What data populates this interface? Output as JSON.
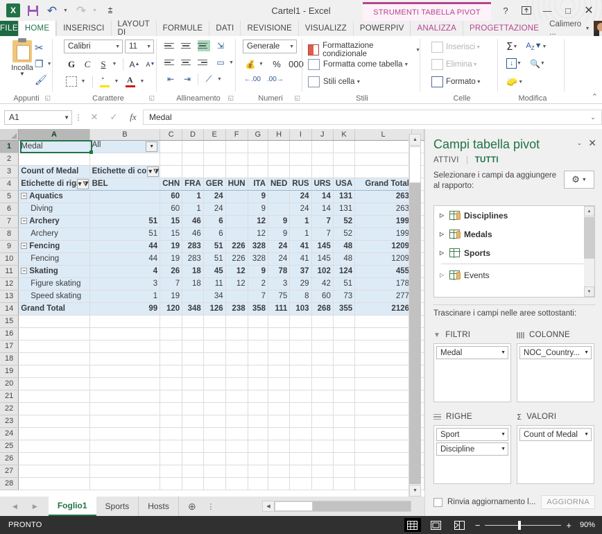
{
  "titlebar": {
    "document_title": "Cartel1 - Excel",
    "contextual_group": "STRUMENTI TABELLA PIVOT",
    "quick_access": [
      "excel-logo",
      "save",
      "undo",
      "redo",
      "customize"
    ],
    "help": "?",
    "ribbon_display": "ribbon-options",
    "minimize": "—",
    "restore": "□",
    "close": "✕"
  },
  "tabs": {
    "file": "FILE",
    "items": [
      {
        "label": "HOME",
        "active": true
      },
      {
        "label": "INSERISCI",
        "active": false
      },
      {
        "label": "LAYOUT DI",
        "active": false
      },
      {
        "label": "FORMULE",
        "active": false
      },
      {
        "label": "DATI",
        "active": false
      },
      {
        "label": "REVISIONE",
        "active": false
      },
      {
        "label": "VISUALIZZ",
        "active": false
      },
      {
        "label": "POWERPIV",
        "active": false
      },
      {
        "label": "ANALIZZA",
        "active": false,
        "contextual": true
      },
      {
        "label": "PROGETTAZIONE",
        "active": false,
        "contextual": true
      }
    ],
    "user": "Calimero ..."
  },
  "ribbon": {
    "groups": [
      {
        "label": "Appunti"
      },
      {
        "label": "Carattere"
      },
      {
        "label": "Allineamento"
      },
      {
        "label": "Numeri"
      },
      {
        "label": "Stili"
      },
      {
        "label": "Celle"
      },
      {
        "label": "Modifica"
      }
    ],
    "clipboard": {
      "paste": "Incolla",
      "cut": "cut-icon",
      "copy": "copy-icon",
      "format_painter": "format-painter-icon"
    },
    "font": {
      "family": "Calibri",
      "size": "11",
      "bold": "G",
      "italic": "C",
      "underline": "S",
      "grow": "A",
      "shrink": "A",
      "highlight": "A",
      "color": "A"
    },
    "number": {
      "format": "Generale",
      "percent": "%",
      "thousands": "000"
    },
    "styles": {
      "conditional": "Formattazione condizionale",
      "as_table": "Formatta come tabella",
      "cell_styles": "Stili cella"
    },
    "cells": {
      "insert": "Inserisci",
      "delete": "Elimina",
      "format": "Formato"
    },
    "editing": {
      "autosum": "Σ",
      "sort": "sort-filter-icon",
      "fill": "fill-icon",
      "find": "find-icon",
      "clear": "clear-icon"
    },
    "collapse": "collapse-ribbon-icon"
  },
  "formula_bar": {
    "name_box": "A1",
    "cancel": "✕",
    "enter": "✓",
    "fx": "fx",
    "value": "Medal",
    "expand": "⌄"
  },
  "grid": {
    "column_headers": [
      "A",
      "B",
      "C",
      "D",
      "E",
      "F",
      "G",
      "H",
      "I",
      "J",
      "K",
      "L"
    ],
    "selected_column": "A",
    "selected_row": 1,
    "row_numbers": [
      1,
      2,
      3,
      4,
      5,
      6,
      7,
      8,
      9,
      10,
      11,
      12,
      13,
      14,
      15,
      16,
      17,
      18,
      19,
      20,
      21,
      22,
      23,
      24,
      25,
      26,
      27,
      28
    ],
    "filter_cell": {
      "label": "Medal",
      "value": "All"
    },
    "pivot_header": {
      "value_caption": "Count of Medal",
      "column_labels": "Etichette di col",
      "row_labels": "Etichette di riga"
    },
    "columns": [
      "BEL",
      "CHN",
      "FRA",
      "GER",
      "HUN",
      "ITA",
      "NED",
      "RUS",
      "URS",
      "USA",
      "Grand Total"
    ],
    "rows": [
      {
        "row": 5,
        "label": "Aquatics",
        "level": 0,
        "expandable": true,
        "bold": true,
        "values": [
          "",
          "60",
          "1",
          "24",
          "",
          "9",
          "",
          "24",
          "14",
          "131",
          "263"
        ]
      },
      {
        "row": 6,
        "label": "Diving",
        "level": 1,
        "expandable": false,
        "bold": false,
        "values": [
          "",
          "60",
          "1",
          "24",
          "",
          "9",
          "",
          "24",
          "14",
          "131",
          "263"
        ]
      },
      {
        "row": 7,
        "label": "Archery",
        "level": 0,
        "expandable": true,
        "bold": true,
        "values": [
          "51",
          "15",
          "46",
          "6",
          "",
          "12",
          "9",
          "1",
          "7",
          "52",
          "199"
        ]
      },
      {
        "row": 8,
        "label": "Archery",
        "level": 1,
        "expandable": false,
        "bold": false,
        "values": [
          "51",
          "15",
          "46",
          "6",
          "",
          "12",
          "9",
          "1",
          "7",
          "52",
          "199"
        ]
      },
      {
        "row": 9,
        "label": "Fencing",
        "level": 0,
        "expandable": true,
        "bold": true,
        "values": [
          "44",
          "19",
          "283",
          "51",
          "226",
          "328",
          "24",
          "41",
          "145",
          "48",
          "1209"
        ]
      },
      {
        "row": 10,
        "label": "Fencing",
        "level": 1,
        "expandable": false,
        "bold": false,
        "values": [
          "44",
          "19",
          "283",
          "51",
          "226",
          "328",
          "24",
          "41",
          "145",
          "48",
          "1209"
        ]
      },
      {
        "row": 11,
        "label": "Skating",
        "level": 0,
        "expandable": true,
        "bold": true,
        "values": [
          "4",
          "26",
          "18",
          "45",
          "12",
          "9",
          "78",
          "37",
          "102",
          "124",
          "455"
        ]
      },
      {
        "row": 12,
        "label": "Figure skating",
        "level": 1,
        "expandable": false,
        "bold": false,
        "values": [
          "3",
          "7",
          "18",
          "11",
          "12",
          "2",
          "3",
          "29",
          "42",
          "51",
          "178"
        ]
      },
      {
        "row": 13,
        "label": "Speed skating",
        "level": 1,
        "expandable": false,
        "bold": false,
        "values": [
          "1",
          "19",
          "",
          "34",
          "",
          "7",
          "75",
          "8",
          "60",
          "73",
          "277"
        ]
      },
      {
        "row": 14,
        "label": "Grand Total",
        "level": 0,
        "expandable": false,
        "bold": true,
        "total": true,
        "values": [
          "99",
          "120",
          "348",
          "126",
          "238",
          "358",
          "111",
          "103",
          "268",
          "355",
          "2126"
        ]
      }
    ]
  },
  "pivot_panel": {
    "title": "Campi tabella pivot",
    "collapse": "⌄",
    "close": "✕",
    "subtabs": [
      {
        "label": "ATTIVI",
        "active": false
      },
      {
        "label": "TUTTI",
        "active": true
      }
    ],
    "instruction": "Selezionare i campi da aggiungere al rapporto:",
    "tools_button": "gear-icon",
    "fields": [
      {
        "label": "Disciplines",
        "bold": true,
        "icon": "table-db-icon"
      },
      {
        "label": "Medals",
        "bold": true,
        "icon": "table-db-icon"
      },
      {
        "label": "Sports",
        "bold": true,
        "icon": "table-icon"
      },
      {
        "label": "Events",
        "bold": false,
        "icon": "table-db-icon"
      }
    ],
    "drag_instruction": "Trascinare i campi nelle aree sottostanti:",
    "zones": [
      {
        "name": "FILTRI",
        "icon": "filter-icon",
        "chips": [
          "Medal"
        ]
      },
      {
        "name": "COLONNE",
        "icon": "columns-icon",
        "chips": [
          "NOC_Country..."
        ]
      },
      {
        "name": "RIGHE",
        "icon": "rows-icon",
        "chips": [
          "Sport",
          "Discipline"
        ]
      },
      {
        "name": "VALORI",
        "icon": "sigma-icon",
        "chips": [
          "Count of Medal"
        ]
      }
    ],
    "defer_label": "Rinvia aggiornamento l...",
    "update_button": "AGGIORNA"
  },
  "sheet_bar": {
    "prev": "◀",
    "next": "▶",
    "sheets": [
      {
        "label": "Foglio1",
        "active": true
      },
      {
        "label": "Sports",
        "active": false
      },
      {
        "label": "Hosts",
        "active": false
      }
    ],
    "add": "+",
    "more": "⋮"
  },
  "status_bar": {
    "state": "PRONTO",
    "views": [
      "normal-view",
      "page-layout-view",
      "page-break-view"
    ],
    "zoom_out": "−",
    "zoom_in": "+",
    "zoom": "90%"
  }
}
